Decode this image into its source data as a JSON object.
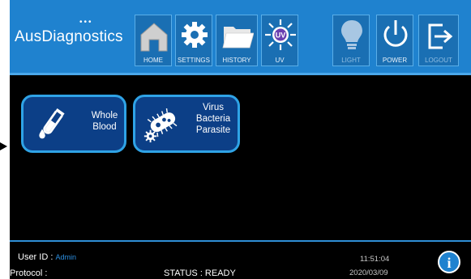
{
  "brand": {
    "logo_text": "AusDiagnostics"
  },
  "toolbar": {
    "buttons": [
      {
        "id": "home",
        "label": "HOME",
        "icon": "home-icon",
        "enabled": true
      },
      {
        "id": "settings",
        "label": "SETTINGS",
        "icon": "gear-icon",
        "enabled": true
      },
      {
        "id": "history",
        "label": "HISTORY",
        "icon": "folder-icon",
        "enabled": true
      },
      {
        "id": "uv",
        "label": "UV",
        "icon": "uv-sun-icon",
        "enabled": true
      },
      {
        "id": "light",
        "label": "LIGHT",
        "icon": "lightbulb-icon",
        "enabled": false
      },
      {
        "id": "power",
        "label": "POWER",
        "icon": "power-icon",
        "enabled": true
      },
      {
        "id": "logout",
        "label": "LOGOUT",
        "icon": "logout-icon",
        "enabled": false
      }
    ],
    "uv_badge": "UV"
  },
  "tiles": [
    {
      "id": "whole-blood",
      "lines": [
        "Whole",
        "Blood"
      ],
      "icon": "test-tube-icon"
    },
    {
      "id": "virus-bacteria-parasite",
      "lines": [
        "Virus",
        "Bacteria",
        "Parasite"
      ],
      "icon": "microbe-icon"
    }
  ],
  "status": {
    "user_id_label": "User ID :",
    "user_id_value": "Admin",
    "protocol_label": "Protocol :",
    "status_text": "STATUS : READY",
    "time": "11:51:04",
    "date": "2020/03/09",
    "info_glyph": "i"
  },
  "colors": {
    "toolbar_bg": "#1f82cf",
    "tile_bg": "#0c3f87",
    "tile_border": "#2fa3e6",
    "accent": "#2d8fe0"
  }
}
